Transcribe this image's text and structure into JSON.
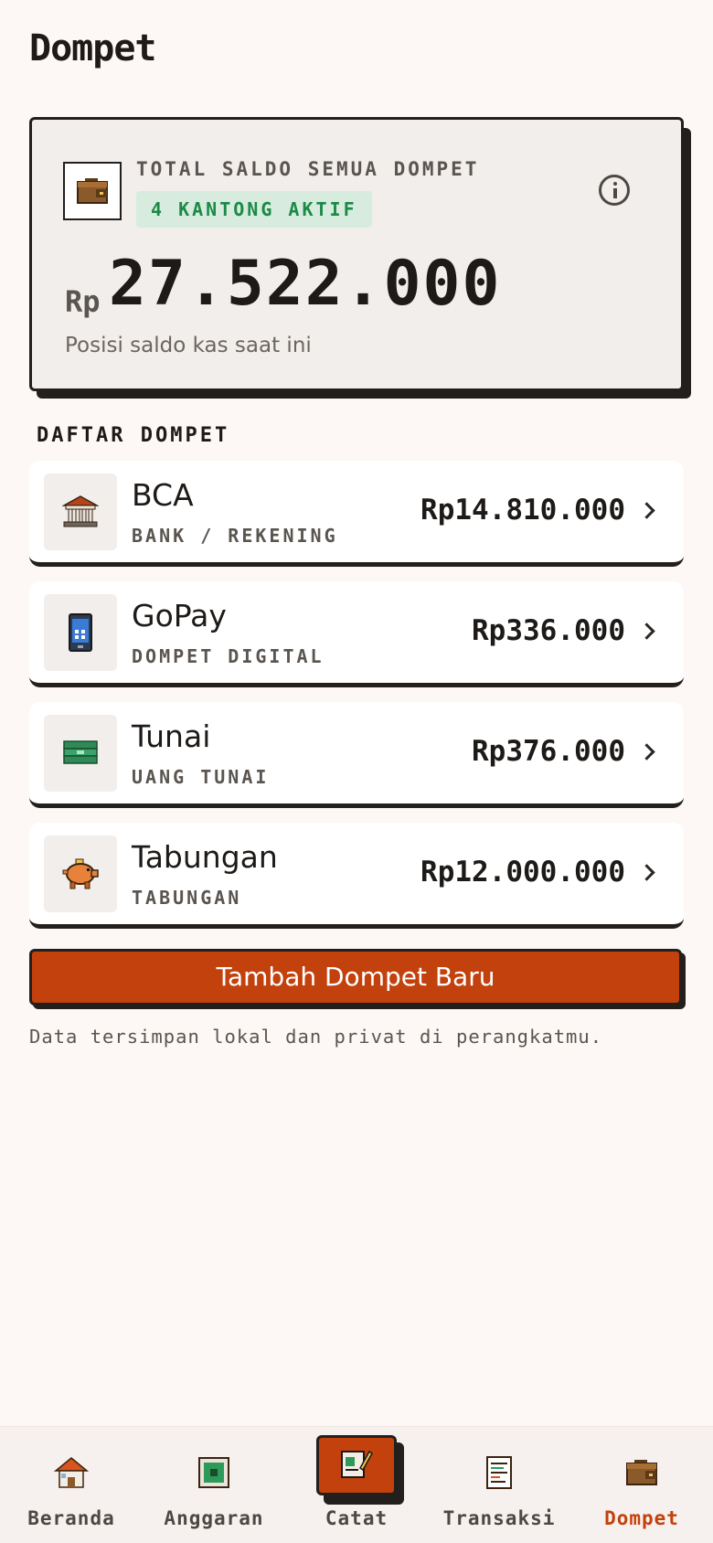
{
  "page": {
    "title": "Dompet"
  },
  "summary": {
    "label": "TOTAL SALDO SEMUA DOMPET",
    "badge": "4 KANTONG AKTIF",
    "currency": "Rp",
    "total": "27.522.000",
    "caption": "Posisi saldo kas saat ini",
    "icon": "wallet-icon",
    "info_icon": "info-icon"
  },
  "wallets": {
    "section_title": "DAFTAR DOMPET",
    "items": [
      {
        "name": "BCA",
        "type": "BANK / REKENING",
        "balance": "Rp14.810.000",
        "icon": "bank-icon"
      },
      {
        "name": "GoPay",
        "type": "DOMPET DIGITAL",
        "balance": "Rp336.000",
        "icon": "phone-icon"
      },
      {
        "name": "Tunai",
        "type": "UANG TUNAI",
        "balance": "Rp376.000",
        "icon": "cash-icon"
      },
      {
        "name": "Tabungan",
        "type": "TABUNGAN",
        "balance": "Rp12.000.000",
        "icon": "piggy-bank-icon"
      }
    ]
  },
  "actions": {
    "add_wallet": "Tambah Dompet Baru"
  },
  "footer_note": "Data tersimpan lokal dan privat di perangkatmu.",
  "nav": {
    "items": [
      {
        "label": "Beranda",
        "icon": "home-icon"
      },
      {
        "label": "Anggaran",
        "icon": "budget-icon"
      },
      {
        "label": "Catat",
        "icon": "note-icon"
      },
      {
        "label": "Transaksi",
        "icon": "receipt-icon"
      },
      {
        "label": "Dompet",
        "icon": "wallet-icon",
        "active": true
      }
    ]
  },
  "colors": {
    "accent": "#c2410c",
    "badge_bg": "#d7ecdf",
    "badge_text": "#1c8a46",
    "background": "#fdf8f5"
  }
}
